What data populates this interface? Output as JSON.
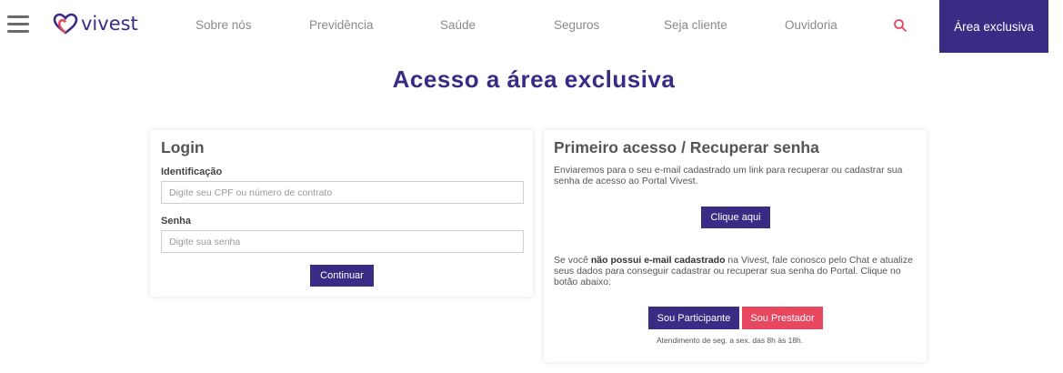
{
  "header": {
    "brand": "vivest",
    "nav": [
      "Sobre nós",
      "Previdência",
      "Saúde",
      "Seguros",
      "Seja cliente",
      "Ouvidoria"
    ],
    "exclusive_area_label": "Área exclusiva"
  },
  "colors": {
    "brand_purple": "#3a2c85",
    "accent_pink": "#e8485f"
  },
  "page": {
    "title": "Acesso a área exclusiva"
  },
  "login": {
    "title": "Login",
    "identificacao_label": "Identificação",
    "identificacao_placeholder": "Digite seu CPF ou número de contrato",
    "senha_label": "Senha",
    "senha_placeholder": "Digite sua senha",
    "continue_label": "Continuar"
  },
  "first_access": {
    "title": "Primeiro acesso / Recuperar senha",
    "intro": "Enviaremos para o seu e-mail cadastrado um link para recuperar ou cadastrar sua senha de acesso ao Portal Vivest.",
    "click_here_label": "Clique aqui",
    "no_email_prefix": "Se você ",
    "no_email_bold": "não possui e-mail cadastrado",
    "no_email_suffix": " na Vivest, fale conosco pelo Chat e atualize seus dados para conseguir cadastrar ou recuperar sua senha do Portal. Clique no botão abaixo:",
    "participant_label": "Sou Participante",
    "provider_label": "Sou Prestador",
    "hours_note": "Atendimento de seg. a sex. das 8h às 18h."
  }
}
